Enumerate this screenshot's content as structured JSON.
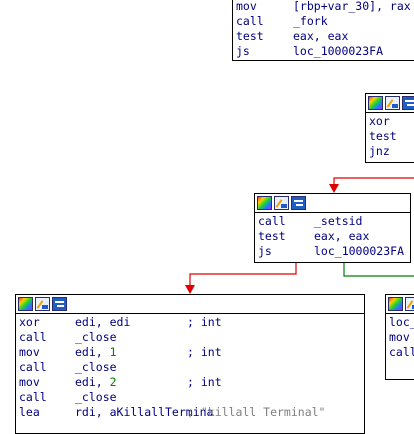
{
  "colors": {
    "instruction": "#000080",
    "immediate": "#008000",
    "comment": "#808080",
    "edge_true": "#e00000",
    "edge_false": "#008000",
    "border": "#000000"
  },
  "icons": [
    "graph-colors-icon",
    "edit-node-icon",
    "group-nodes-icon"
  ],
  "blocks": {
    "top": {
      "lines": [
        {
          "mn": "mov",
          "op": "[rbp+var_30], rax"
        },
        {
          "mn": "call",
          "op": "_fork"
        },
        {
          "mn": "test",
          "op": "eax, eax"
        },
        {
          "mn": "js",
          "op": "loc_1000023FA"
        }
      ]
    },
    "right_mid": {
      "lines": [
        {
          "mn": "xor",
          "op": ""
        },
        {
          "mn": "test",
          "op": ""
        },
        {
          "mn": "jnz",
          "op": ""
        }
      ]
    },
    "center": {
      "lines": [
        {
          "mn": "call",
          "op": "_setsid"
        },
        {
          "mn": "test",
          "op": "eax, eax"
        },
        {
          "mn": "js",
          "op": "loc_1000023FA"
        }
      ]
    },
    "left": {
      "lines": [
        {
          "mn": "xor",
          "op": "edi, edi",
          "cmt": "; int"
        },
        {
          "mn": "call",
          "op": "_close"
        },
        {
          "mn": "mov",
          "op": "edi, ",
          "num": "1",
          "cmt": "; int"
        },
        {
          "mn": "call",
          "op": "_close"
        },
        {
          "mn": "mov",
          "op": "edi, ",
          "num": "2",
          "cmt": "; int"
        },
        {
          "mn": "call",
          "op": "_close"
        },
        {
          "mn": "lea",
          "op": "rdi, aKillallTermina",
          "cmt": "; \"killall Terminal\""
        }
      ]
    },
    "right_bottom": {
      "lines": [
        {
          "mn": "loc_",
          "op": ""
        },
        {
          "mn": "mov",
          "op": ""
        },
        {
          "mn": "call",
          "op": ""
        }
      ]
    }
  }
}
